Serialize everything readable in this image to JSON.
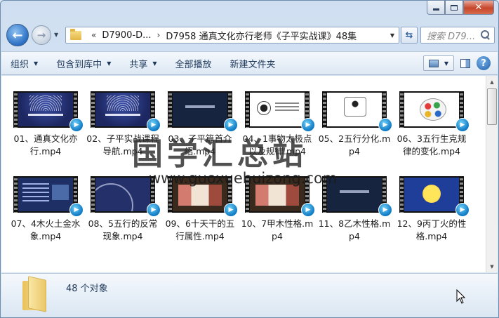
{
  "window": {
    "caption": {
      "close_glyph": "✕"
    }
  },
  "nav": {
    "back_glyph": "←",
    "forward_glyph": "→",
    "history_glyph": "▼",
    "breadcrumb": {
      "overflow": "«",
      "parent": "D7900-D...",
      "separator": "›",
      "current": "D7958 通真文化亦行老师《子平实战课》48集"
    },
    "dropdown_glyph": "▼",
    "refresh_glyph": "⇆",
    "search_placeholder": "搜索 D79..."
  },
  "toolbar": {
    "organize": "组织",
    "include_in_library": "包含到库中",
    "share": "共享",
    "play_all": "全部播放",
    "new_folder": "新建文件夹",
    "arrow": "▼",
    "help": "?"
  },
  "files": [
    {
      "name": "01、通真文化亦行.mp4",
      "thumb": "t-title"
    },
    {
      "name": "02、子平实战课程导航.mp4",
      "thumb": "t-title"
    },
    {
      "name": "03、子平篇首介绍.mp4",
      "thumb": "t-dark"
    },
    {
      "name": "04、1事物太极点以及规律.mp4",
      "thumb": "t-diagram"
    },
    {
      "name": "05、2五行分化.mp4",
      "thumb": "t-circle"
    },
    {
      "name": "06、3五行生克规律的变化.mp4",
      "thumb": "t-color"
    },
    {
      "name": "07、4木火土金水象.mp4",
      "thumb": "t-slide"
    },
    {
      "name": "08、5五行的反常现象.mp4",
      "thumb": "t-curve"
    },
    {
      "name": "09、6十天干的五行属性.mp4",
      "thumb": "t-wood"
    },
    {
      "name": "10、7甲木性格.mp4",
      "thumb": "t-wood"
    },
    {
      "name": "11、8乙木性格.mp4",
      "thumb": "t-dark"
    },
    {
      "name": "12、9丙丁火的性格.mp4",
      "thumb": "t-sun"
    }
  ],
  "play_badge_glyph": "▶",
  "watermark": {
    "title": "国学汇总站",
    "url": "www.guoxuehuizong.com"
  },
  "scrollbar": {
    "up": "▲",
    "down": "▼"
  },
  "details": {
    "count": "48 个对象"
  }
}
